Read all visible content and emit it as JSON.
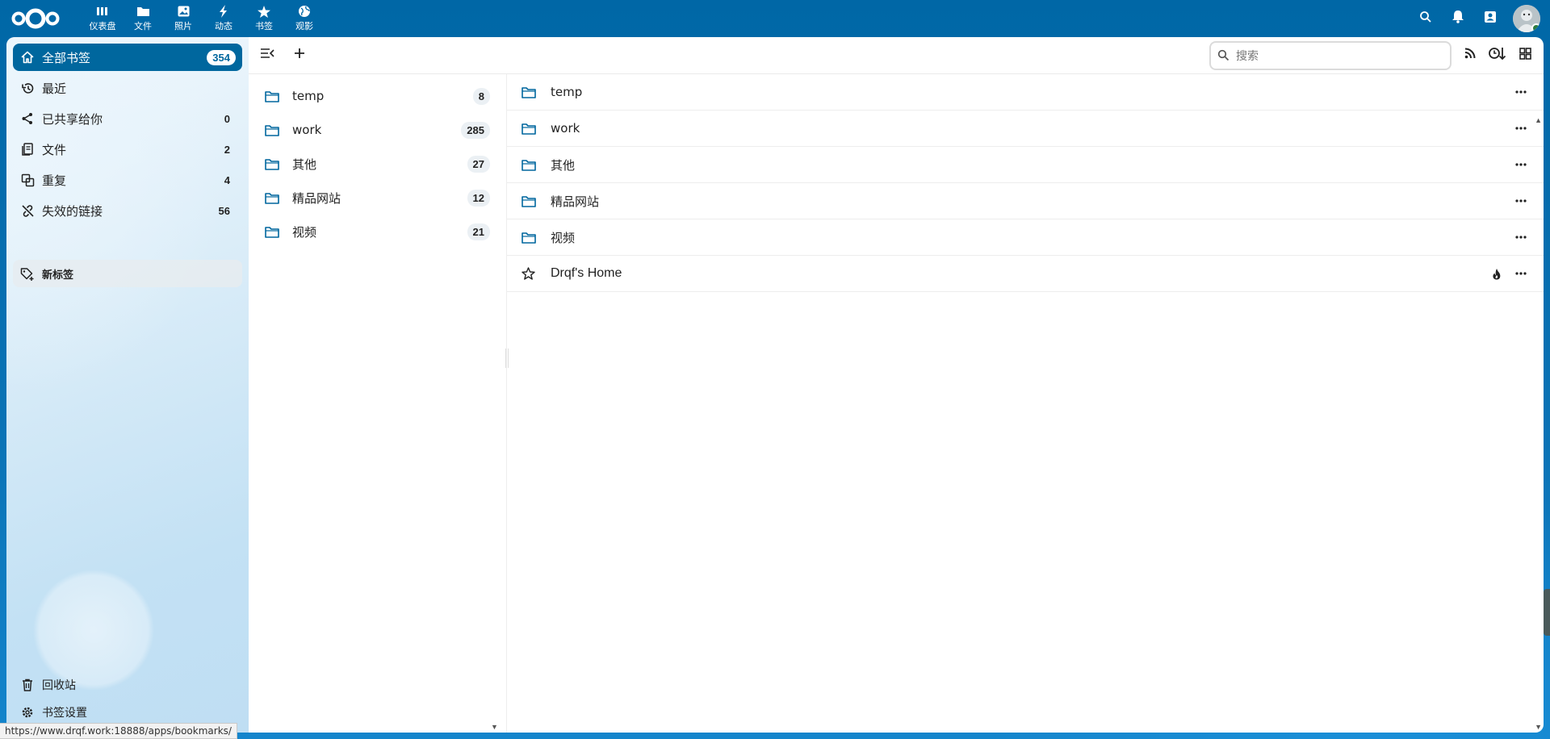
{
  "header": {
    "apps": [
      {
        "label": "仪表盘",
        "icon": "dashboard-icon"
      },
      {
        "label": "文件",
        "icon": "folder-icon"
      },
      {
        "label": "照片",
        "icon": "photos-icon"
      },
      {
        "label": "动态",
        "icon": "activity-icon"
      },
      {
        "label": "书签",
        "icon": "star-icon"
      },
      {
        "label": "观影",
        "icon": "globe-icon"
      }
    ]
  },
  "sidebar": {
    "items": [
      {
        "label": "全部书签",
        "count": "354"
      },
      {
        "label": "最近",
        "count": ""
      },
      {
        "label": "已共享给你",
        "count": "0"
      },
      {
        "label": "文件",
        "count": "2"
      },
      {
        "label": "重复",
        "count": "4"
      },
      {
        "label": "失效的链接",
        "count": "56"
      }
    ],
    "new_tag": "新标签",
    "trash": "回收站",
    "settings": "书签设置"
  },
  "search": {
    "placeholder": "搜索"
  },
  "folders": [
    {
      "name": "temp",
      "count": "8"
    },
    {
      "name": "work",
      "count": "285"
    },
    {
      "name": "其他",
      "count": "27"
    },
    {
      "name": "精品网站",
      "count": "12"
    },
    {
      "name": "视频",
      "count": "21"
    }
  ],
  "items": [
    {
      "name": "temp",
      "type": "folder"
    },
    {
      "name": "work",
      "type": "folder"
    },
    {
      "name": "其他",
      "type": "folder"
    },
    {
      "name": "精品网站",
      "type": "folder"
    },
    {
      "name": "视频",
      "type": "folder"
    },
    {
      "name": "Drqf's Home",
      "type": "bookmark"
    }
  ],
  "status_url": "https://www.drqf.work:18888/apps/bookmarks/",
  "colors": {
    "primary": "#00679e",
    "header": "#0069a8"
  }
}
